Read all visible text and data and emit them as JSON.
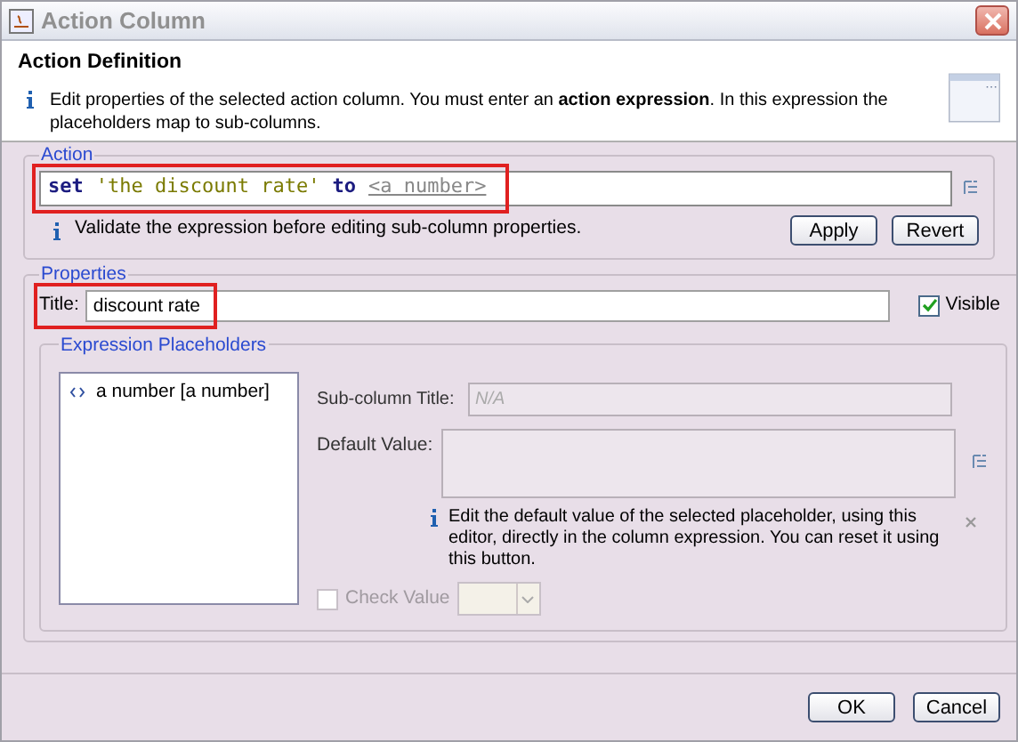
{
  "window": {
    "title": "Action Column"
  },
  "header": {
    "title": "Action Definition",
    "description": "Edit properties of the selected action column. You must enter an **action expression**. In this expression the placeholders map to sub-columns."
  },
  "action": {
    "legend": "Action",
    "highlighted": true,
    "expression": [
      {
        "kind": "keyword",
        "text": "set"
      },
      {
        "kind": "string",
        "text": "'the discount rate'"
      },
      {
        "kind": "keyword",
        "text": "to"
      },
      {
        "kind": "placeholder",
        "text": "<a number>"
      }
    ],
    "hint": "Validate the expression before editing sub-column properties.",
    "buttons": [
      "Apply",
      "Revert"
    ]
  },
  "properties": {
    "legend": "Properties",
    "title_label": "Title:",
    "title_value": "discount rate",
    "title_highlighted": true,
    "visible": {
      "label": "Visible",
      "checked": true
    },
    "placeholders": {
      "legend": "Expression Placeholders",
      "items": [
        {
          "label": "a number [a number]",
          "selected": false
        }
      ],
      "subcolumn_title": {
        "label": "Sub-column Title:",
        "placeholder": "N/A",
        "disabled": true
      },
      "default_value": {
        "label": "Default Value:"
      },
      "info": "Edit the default value of the selected placeholder, using this editor, directly in the column expression. You can reset it using this button.",
      "check_value": {
        "label": "Check Value",
        "checked": false,
        "disabled": true
      }
    }
  },
  "footer": {
    "buttons": [
      "OK",
      "Cancel"
    ]
  }
}
